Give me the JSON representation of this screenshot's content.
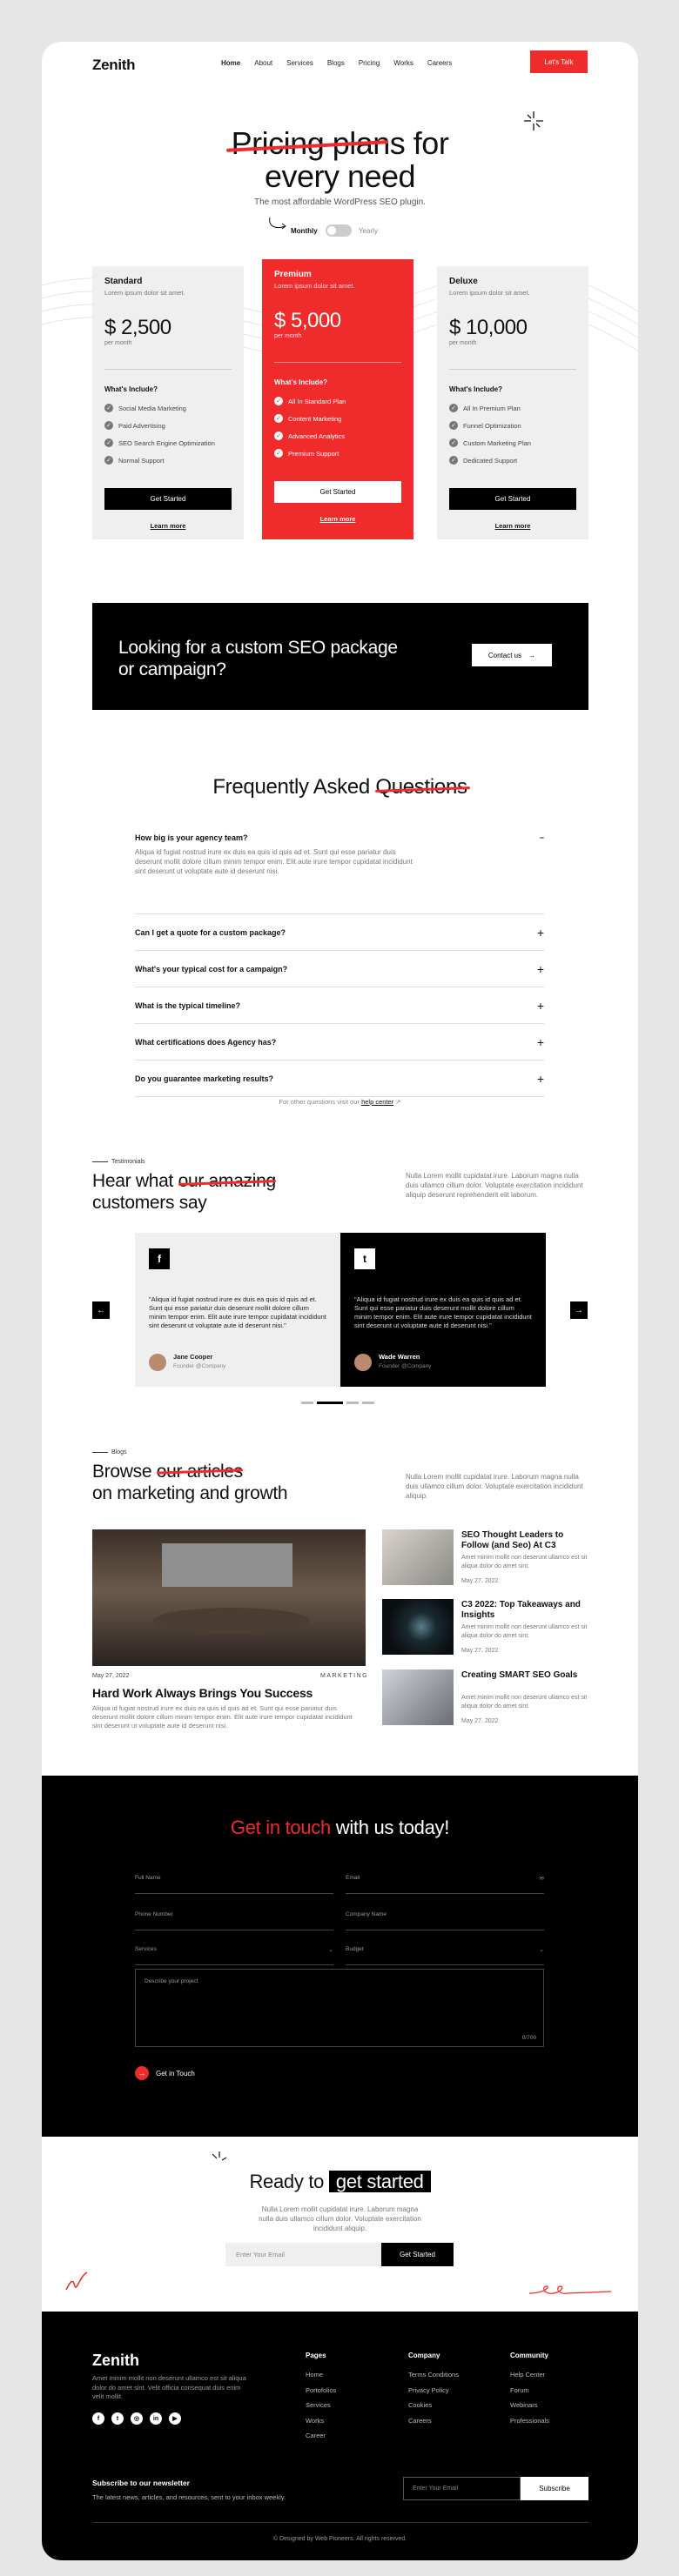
{
  "nav": {
    "logo": "Zenith",
    "items": [
      "Home",
      "About",
      "Services",
      "Blogs",
      "Pricing",
      "Works",
      "Careers"
    ],
    "cta": "Let's Talk"
  },
  "hero": {
    "title_a": "Pricing plans",
    "title_b": "for",
    "title_c": "every need",
    "subtitle": "The most affordable WordPress SEO plugin.",
    "monthly": "Monthly",
    "yearly": "Yearly"
  },
  "plans": [
    {
      "name": "Standard",
      "desc": "Lorem ipsum dolor sit amet.",
      "price": "$ 2,500",
      "per": "per month",
      "include": "What's Include?",
      "features": [
        "Social Media Marketing",
        "Paid Advertising",
        "SEO Search Engine Optimization",
        "Normal Support"
      ],
      "button": "Get Started",
      "learn": "Learn more"
    },
    {
      "name": "Premium",
      "desc": "Lorem ipsum dolor sit amet.",
      "price": "$ 5,000",
      "per": "per month",
      "include": "What's Include?",
      "features": [
        "All In Standard Plan",
        "Content Marketing",
        "Advanced Analytics",
        "Premium Support"
      ],
      "button": "Get Started",
      "learn": "Learn more"
    },
    {
      "name": "Deluxe",
      "desc": "Lorem ipsum dolor sit amet.",
      "price": "$ 10,000",
      "per": "per month",
      "include": "What's Include?",
      "features": [
        "All In Premium Plan",
        "Funnel Optimization",
        "Custom Marketing Plan",
        "Dedicated Support"
      ],
      "button": "Get Started",
      "learn": "Learn more"
    }
  ],
  "custom": {
    "title": "Looking for a custom SEO package or campaign?",
    "button": "Contact us"
  },
  "faq": {
    "title_a": "Frequently Asked",
    "title_b": "Questions",
    "open_q": "How big is your agency team?",
    "open_a": "Aliqua id fugiat nostrud irure ex duis ea quis id quis ad et. Sunt qui esse pariatur duis deserunt mollit dolore cillum minim tempor enim. Elit aute irure tempor cupidatat incididunt sint deserunt ut voluptate aute id deserunt nisi.",
    "items": [
      "Can I get a quote for a custom package?",
      "What's your typical cost for a campaign?",
      "What is the typical timeline?",
      "What certifications does Agency has?",
      "Do you guarantee marketing results?"
    ],
    "help_pre": "For other questions visit our",
    "help_link": "help center"
  },
  "testimonials": {
    "tag": "Testimonials",
    "title_a": "Hear what",
    "title_b": "our amazing",
    "title_c": "customers say",
    "side": "Nulla Lorem mollit cupidatat irure. Laborum magna nulla duis ullamco cillum dolor. Voluptate exercitation incididunt aliquip deserunt reprehenderit elit laborum.",
    "cards": [
      {
        "icon": "f",
        "quote": "\"Aliqua id fugiat nostrud irure ex duis ea quis id quis ad et. Sunt qui esse pariatur duis deserunt mollit dolore cillum minim tempor enim. Elit aute irure tempor cupidatat incididunt sint deserunt ut voluptate aute id deserunt nisi.\"",
        "name": "Jane Cooper",
        "role": "Founder @Company"
      },
      {
        "icon": "t",
        "quote": "\"Aliqua id fugiat nostrud irure ex duis ea quis id quis ad et. Sunt qui esse pariatur duis deserunt mollit dolore cillum minim tempor enim. Elit aute irure tempor cupidatat incididunt sint deserunt ut voluptate aute id deserunt nisi.\"",
        "name": "Wade Warren",
        "role": "Founder @Company"
      }
    ]
  },
  "blogs": {
    "tag": "Blogs",
    "title_a": "Browse",
    "title_b": "our articles",
    "title_c": "on marketing and growth",
    "side": "Nulla Lorem mollit cupidatat irure. Laborum magna nulla duis ullamco cillum dolor. Voluptate exercitation incididunt aliquip.",
    "main": {
      "date": "May 27, 2022",
      "category": "MARKETING",
      "title": "Hard Work Always Brings You Success",
      "desc": "Aliqua id fugiat nostrud irure ex duis ea quis id quis ad et. Sunt qui esse pariatur duis deserunt mollit dolore cillum minim tempor enim. Elit aute irure tempor cupidatat incididunt sint deserunt ut voluptate aute id deserunt nisi."
    },
    "posts": [
      {
        "title": "SEO Thought Leaders to Follow (and Seo) At C3",
        "desc": "Amet minim mollit non deserunt ullamco est sit aliqua dolor do amet sint.",
        "date": "May 27, 2022"
      },
      {
        "title": "C3 2022: Top Takeaways and Insights",
        "desc": "Amet minim mollit non deserunt ullamco est sit aliqua dolor do amet sint.",
        "date": "May 27, 2022"
      },
      {
        "title": "Creating SMART SEO Goals",
        "desc": "Amet minim mollit non deserunt ullamco est sit aliqua dolor do amet sint.",
        "date": "May 27, 2022"
      }
    ]
  },
  "contact": {
    "title_a": "Get in touch",
    "title_b": "with us today!",
    "fields": [
      "Full Name",
      "Email",
      "Phone Number",
      "Company Name",
      "Services",
      "Budget"
    ],
    "project": "Describe your project",
    "count": "0/700",
    "button": "Get in Touch"
  },
  "cta": {
    "title_a": "Ready to",
    "title_b": "get started",
    "desc": "Nulla Lorem mollit cupidatat irure. Laborum magna nulla duis ullamco cillum dolor. Voluptate exercitation incididunt aliquip.",
    "placeholder": "Enter Your Email",
    "button": "Get Started"
  },
  "footer": {
    "logo": "Zenith",
    "desc": "Amet minim mollit non deserunt ullamco est sit aliqua dolor do amet sint. Velit officia consequat duis enim velit mollit.",
    "cols": [
      {
        "title": "Pages",
        "items": [
          "Home",
          "Portofolios",
          "Services",
          "Works",
          "Career"
        ]
      },
      {
        "title": "Company",
        "items": [
          "Terms Conditions",
          "Privacy Policy",
          "Cookies",
          "Careers"
        ]
      },
      {
        "title": "Community",
        "items": [
          "Help Center",
          "Forum",
          "Webinars",
          "Professionals"
        ]
      }
    ],
    "sub_title": "Subscribe to our newsletter",
    "sub_desc": "The latest news, articles, and resources, sent to your inbox weekly.",
    "sub_placeholder": "Enter Your Email",
    "sub_button": "Subscribe",
    "copyright": "© Designed by Web Pioneers. All rights reserved."
  }
}
